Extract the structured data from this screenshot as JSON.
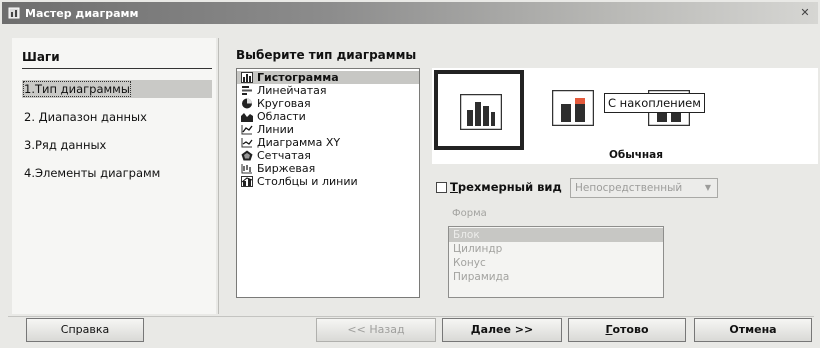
{
  "window": {
    "title": "Мастер диаграмм"
  },
  "steps": {
    "title": "Шаги",
    "items": [
      {
        "label": "1.Тип диаграммы",
        "active": true
      },
      {
        "label": "2. Диапазон данных",
        "active": false
      },
      {
        "label": "3.Ряд данных",
        "active": false
      },
      {
        "label": "4.Элементы диаграмм",
        "active": false
      }
    ]
  },
  "chart_type": {
    "heading": "Выберите тип диаграммы",
    "types": [
      {
        "label": "Гистограмма",
        "icon": "column-chart-icon",
        "selected": true
      },
      {
        "label": "Линейчатая",
        "icon": "bar-chart-icon",
        "selected": false
      },
      {
        "label": "Круговая",
        "icon": "pie-chart-icon",
        "selected": false
      },
      {
        "label": "Области",
        "icon": "area-chart-icon",
        "selected": false
      },
      {
        "label": "Линии",
        "icon": "line-chart-icon",
        "selected": false
      },
      {
        "label": "Диаграмма XY",
        "icon": "xy-chart-icon",
        "selected": false
      },
      {
        "label": "Сетчатая",
        "icon": "net-chart-icon",
        "selected": false
      },
      {
        "label": "Биржевая",
        "icon": "stock-chart-icon",
        "selected": false
      },
      {
        "label": "Столбцы и линии",
        "icon": "column-line-chart-icon",
        "selected": false
      }
    ]
  },
  "variants": {
    "selected_label": "Обычная",
    "tooltip": "С накоплением",
    "items": [
      {
        "name": "normal",
        "icon": "normal-column-icon",
        "selected": true
      },
      {
        "name": "stacked",
        "icon": "stacked-column-icon",
        "selected": false
      },
      {
        "name": "percent-stacked",
        "icon": "percent-stacked-column-icon",
        "selected": false
      }
    ]
  },
  "three_d": {
    "checkbox_label_underlined": "Т",
    "checkbox_label_rest": "рехмерный вид",
    "checked": false,
    "select_value": "Непосредственный"
  },
  "shape": {
    "label": "Форма",
    "options": [
      {
        "label": "Блок",
        "selected": true
      },
      {
        "label": "Цилиндр",
        "selected": false
      },
      {
        "label": "Конус",
        "selected": false
      },
      {
        "label": "Пирамида",
        "selected": false
      }
    ]
  },
  "buttons": {
    "help": "Справка",
    "back": "<< Назад",
    "next": "Далее >>",
    "finish_underlined": "Г",
    "finish_rest": "отово",
    "cancel": "Отмена"
  },
  "colors": {
    "bar_fill": "#2e2e2e",
    "stack_highlight": "#e45a3c",
    "selection": "#c7c7c4"
  }
}
